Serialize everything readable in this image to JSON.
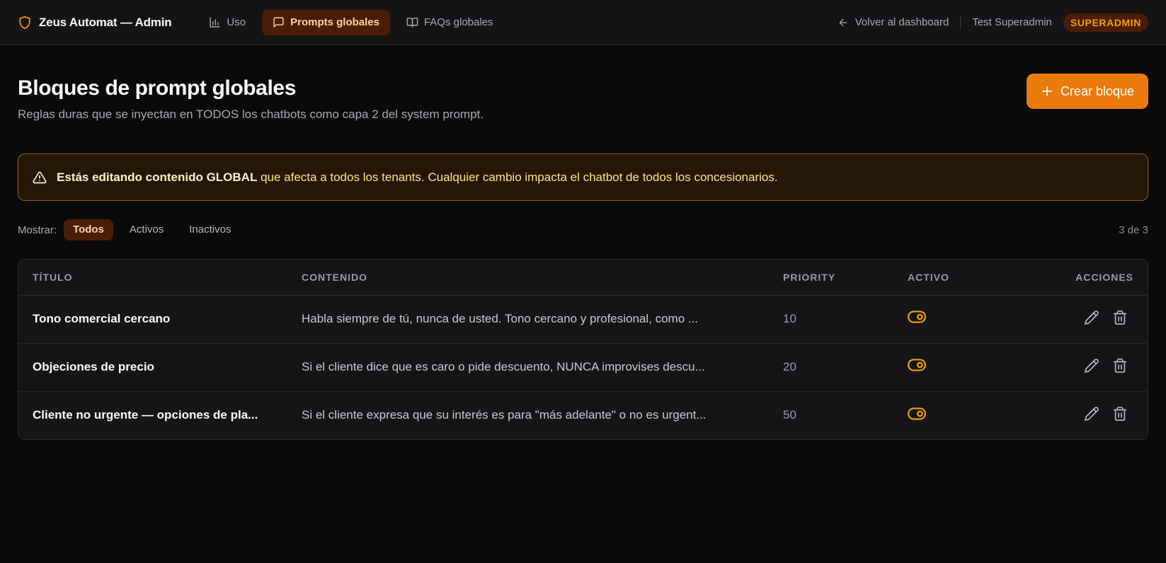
{
  "brand": {
    "name": "Zeus Automat — Admin",
    "icon": "shield-icon"
  },
  "nav": [
    {
      "label": "Uso",
      "icon": "bar-chart-icon",
      "active": false
    },
    {
      "label": "Prompts globales",
      "icon": "message-square-icon",
      "active": true
    },
    {
      "label": "FAQs globales",
      "icon": "book-open-icon",
      "active": false
    }
  ],
  "topbar": {
    "back_label": "Volver al dashboard",
    "user_name": "Test Superadmin",
    "role_badge": "SUPERADMIN"
  },
  "page": {
    "title": "Bloques de prompt globales",
    "subtitle": "Reglas duras que se inyectan en TODOS los chatbots como capa 2 del system prompt.",
    "create_button": "Crear bloque"
  },
  "warning": {
    "bold": "Estás editando contenido GLOBAL",
    "text": " que afecta a todos los tenants. Cualquier cambio impacta el chatbot de todos los concesionarios."
  },
  "filter": {
    "label": "Mostrar:",
    "options": [
      "Todos",
      "Activos",
      "Inactivos"
    ],
    "selected": "Todos",
    "count": "3 de 3"
  },
  "table": {
    "headers": {
      "title": "TÍTULO",
      "content": "CONTENIDO",
      "priority": "PRIORITY",
      "active": "ACTIVO",
      "actions": "ACCIONES"
    },
    "rows": [
      {
        "title": "Tono comercial cercano",
        "content": "Habla siempre de tú, nunca de usted. Tono cercano y profesional, como ...",
        "priority": "10",
        "active": true
      },
      {
        "title": "Objeciones de precio",
        "content": "Si el cliente dice que es caro o pide descuento, NUNCA improvises descu...",
        "priority": "20",
        "active": true
      },
      {
        "title": "Cliente no urgente — opciones de pla...",
        "content": "Si el cliente expresa que su interés es para \"más adelante\" o no es urgent...",
        "priority": "50",
        "active": true
      }
    ]
  },
  "colors": {
    "accent": "#ea7a0c",
    "accent_soft": "#4a1d06",
    "warning_border": "#9a5a14",
    "toggle": "#f59e0b"
  }
}
